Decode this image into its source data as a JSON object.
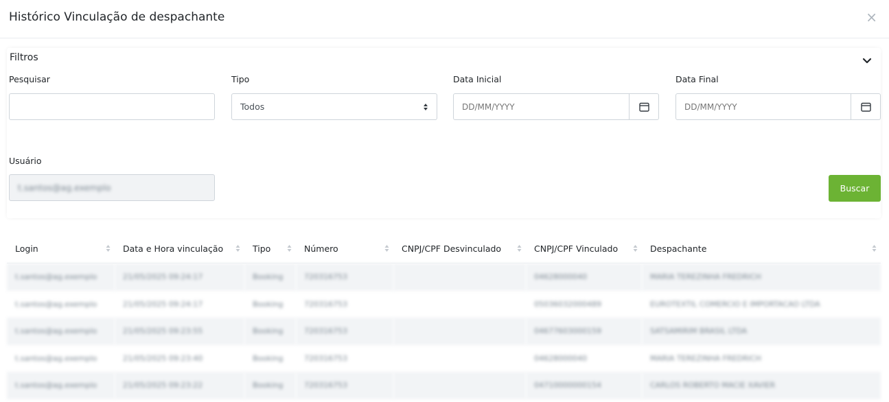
{
  "modal": {
    "title": "Histórico Vinculação de despachante",
    "close_glyph": "×"
  },
  "filters": {
    "title": "Filtros",
    "pesquisar": {
      "label": "Pesquisar",
      "value": "",
      "placeholder": ""
    },
    "tipo": {
      "label": "Tipo",
      "selected": "Todos"
    },
    "data_inicial": {
      "label": "Data Inicial",
      "placeholder": "DD/MM/YYYY"
    },
    "data_final": {
      "label": "Data Final",
      "placeholder": "DD/MM/YYYY"
    },
    "usuario": {
      "label": "Usuário",
      "value": "t.santos@ag.exemplo"
    },
    "buscar_label": "Buscar"
  },
  "table": {
    "headers": [
      "Login",
      "Data e Hora vinculação",
      "Tipo",
      "Número",
      "CNPJ/CPF Desvinculado",
      "CNPJ/CPF Vinculado",
      "Despachante"
    ],
    "rows": [
      [
        "t.santos@ag.exemplo",
        "21/05/2025 09:24:17",
        "Booking",
        "720316753",
        "",
        "04628000040",
        "MARIA TEREZINHA FREDRICH"
      ],
      [
        "t.santos@ag.exemplo",
        "21/05/2025 09:24:17",
        "Booking",
        "720316753",
        "",
        "05036032000489",
        "EUROTEXTIL COMERCIO E IMPORTACAO LTDA"
      ],
      [
        "t.santos@ag.exemplo",
        "21/05/2025 09:23:55",
        "Booking",
        "720316753",
        "",
        "04677603000159",
        "SATSAMIRIM BRASIL LTDA"
      ],
      [
        "t.santos@ag.exemplo",
        "21/05/2025 09:23:40",
        "Booking",
        "720316753",
        "",
        "04628000040",
        "MARIA TEREZINHA FREDRICH"
      ],
      [
        "t.santos@ag.exemplo",
        "21/05/2025 09:23:22",
        "Booking",
        "720316753",
        "",
        "04710000000154",
        "CARLOS ROBERTO MACIE XAVIER"
      ]
    ]
  },
  "colors": {
    "accent": "#6cb334",
    "row_stripe": "#f2f4f6"
  },
  "icons": {
    "close": "close-icon",
    "collapse": "chevron-down-icon",
    "calendar": "calendar-icon",
    "sort": "sort-icon"
  }
}
